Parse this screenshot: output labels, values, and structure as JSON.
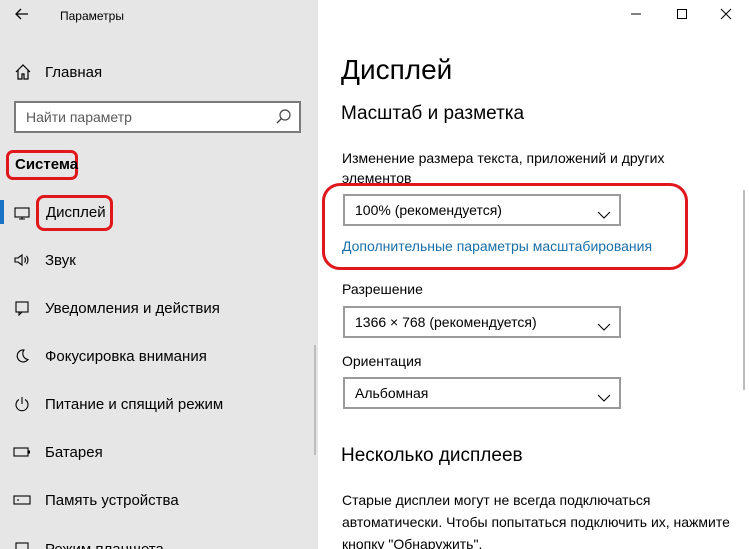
{
  "window": {
    "title": "Параметры",
    "back_icon": "arrow-left-icon",
    "controls": [
      "minimize-icon",
      "maximize-icon",
      "close-icon"
    ]
  },
  "sidebar": {
    "home_label": "Главная",
    "search_placeholder": "Найти параметр",
    "section_title": "Система",
    "items": [
      {
        "label": "Дисплей",
        "icon": "monitor-icon",
        "active": true
      },
      {
        "label": "Звук",
        "icon": "speaker-icon"
      },
      {
        "label": "Уведомления и действия",
        "icon": "notification-icon"
      },
      {
        "label": "Фокусировка внимания",
        "icon": "moon-icon"
      },
      {
        "label": "Питание и спящий режим",
        "icon": "power-icon"
      },
      {
        "label": "Батарея",
        "icon": "battery-icon"
      },
      {
        "label": "Память устройства",
        "icon": "storage-icon"
      },
      {
        "label": "Режим планшета",
        "icon": "tablet-icon"
      }
    ]
  },
  "main": {
    "page_title": "Дисплей",
    "scale_section": "Масштаб и разметка",
    "scale_label": "Изменение размера текста, приложений и других элементов",
    "scale_value": "100% (рекомендуется)",
    "scale_link": "Дополнительные параметры масштабирования",
    "resolution_label": "Разрешение",
    "resolution_value": "1366 × 768 (рекомендуется)",
    "orientation_label": "Ориентация",
    "orientation_value": "Альбомная",
    "multi_section": "Несколько дисплеев",
    "multi_text": "Старые дисплеи могут не всегда подключаться автоматически. Чтобы попытаться подключить их, нажмите кнопку \"Обнаружить\"."
  },
  "colors": {
    "sidebar_bg": "#e6e6e6",
    "annotation_red": "#e0181c",
    "link_blue": "#1a6fa8",
    "accent_blue": "#1a73c7"
  }
}
